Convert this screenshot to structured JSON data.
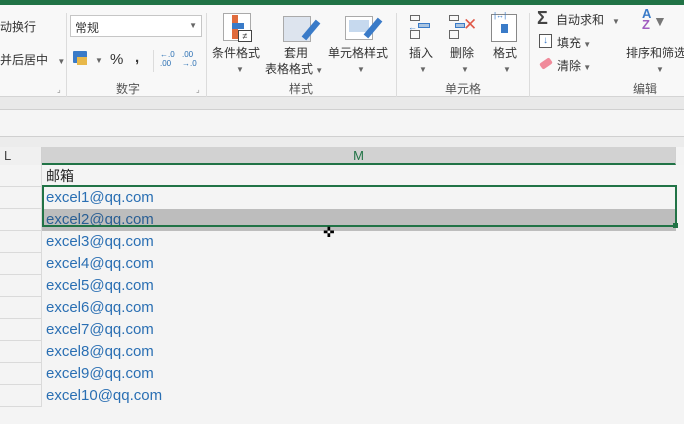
{
  "ribbon": {
    "alignment": {
      "wrap_text": "动换行",
      "merge_center": "并后居中"
    },
    "number": {
      "format_value": "常规",
      "percent": "%",
      "comma": ",",
      "increase_decimal": "←.0 .00",
      "decrease_decimal": ".00 →.0",
      "group_label": "数字"
    },
    "styles": {
      "conditional_format": "条件格式",
      "format_as_table_line1": "套用",
      "format_as_table_line2": "表格格式",
      "cell_styles": "单元格样式",
      "group_label": "样式"
    },
    "cells": {
      "insert": "插入",
      "delete": "删除",
      "format": "格式",
      "group_label": "单元格"
    },
    "editing": {
      "autosum": "自动求和",
      "fill": "填充",
      "clear": "清除",
      "sort_filter": "排序和筛选",
      "group_label": "编辑"
    }
  },
  "columns": [
    "L",
    "M"
  ],
  "rows": [
    "邮箱",
    "excel1@qq.com",
    "excel2@qq.com",
    "excel3@qq.com",
    "excel4@qq.com",
    "excel5@qq.com",
    "excel6@qq.com",
    "excel7@qq.com",
    "excel8@qq.com",
    "excel9@qq.com",
    "excel10@qq.com"
  ],
  "colors": {
    "accent": "#217346",
    "link_text": "#2a6fb3"
  }
}
